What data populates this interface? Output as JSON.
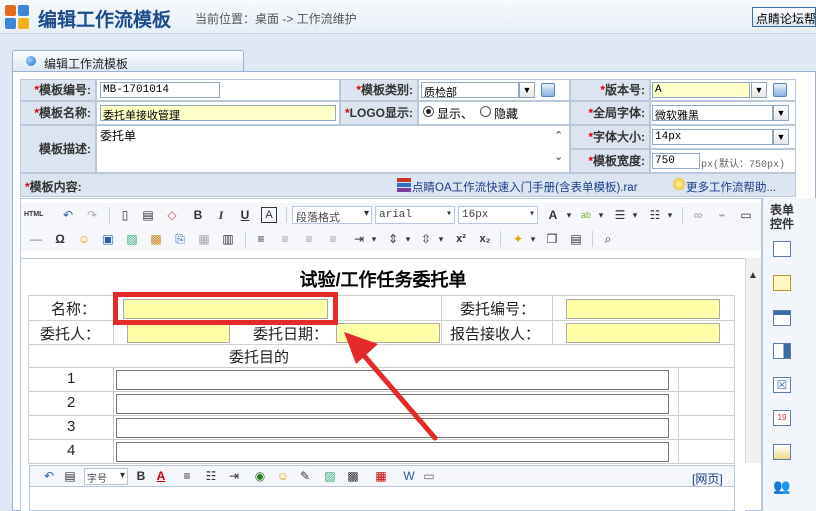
{
  "header": {
    "title": "编辑工作流模板",
    "breadcrumb": "当前位置：桌面 -> 工作流维护",
    "forum_button": "点睛论坛帮"
  },
  "panel": {
    "tab_label": "编辑工作流模板"
  },
  "form": {
    "template_no_label": "模板编号:",
    "template_no_value": "MB-1701014",
    "template_type_label": "模板类别:",
    "template_type_value": "质检部",
    "version_label": "版本号:",
    "version_value": "A",
    "template_name_label": "模板名称:",
    "template_name_value": "委托单接收管理",
    "logo_label": "LOGO显示:",
    "logo_show": "显示、",
    "logo_hide": "隐藏",
    "global_font_label": "全局字体:",
    "global_font_value": "微软雅黑",
    "desc_label": "模板描述:",
    "desc_value": "委托单",
    "font_size_label": "字体大小:",
    "font_size_value": "14px",
    "width_label": "模板宽度:",
    "width_value": "750",
    "width_hint": "px(默认：750px)",
    "content_label": "模板内容:",
    "manual_link": "点睛OA工作流快速入门手册(含表单模板).rar",
    "help_link": "更多工作流帮助..."
  },
  "toolbar": {
    "html_label": "HTML",
    "paragraph_format": "段落格式",
    "font_family": "arial",
    "font_size": "16px",
    "bold": "B",
    "italic": "I",
    "underline": "U",
    "text_a": "A",
    "omega": "Ω",
    "sup": "x²",
    "sub": "x₂"
  },
  "controls": {
    "title": "表单控件"
  },
  "document": {
    "title": "试验/工作任务委托单",
    "name_label": "名称：",
    "entrust_no_label": "委托编号：",
    "client_label": "委托人：",
    "entrust_date_label": "委托日期：",
    "receiver_label": "报告接收人：",
    "purpose_label": "委托目的",
    "rows": [
      "1",
      "2",
      "3",
      "4"
    ]
  },
  "mini_toolbar": {
    "font_size_select": "字号",
    "bold": "B",
    "web_link": "[网页]"
  },
  "colors": {
    "highlight": "#e52a2a",
    "input_yellow": "#ffffa8",
    "label_bg": "#dbe4ef"
  }
}
